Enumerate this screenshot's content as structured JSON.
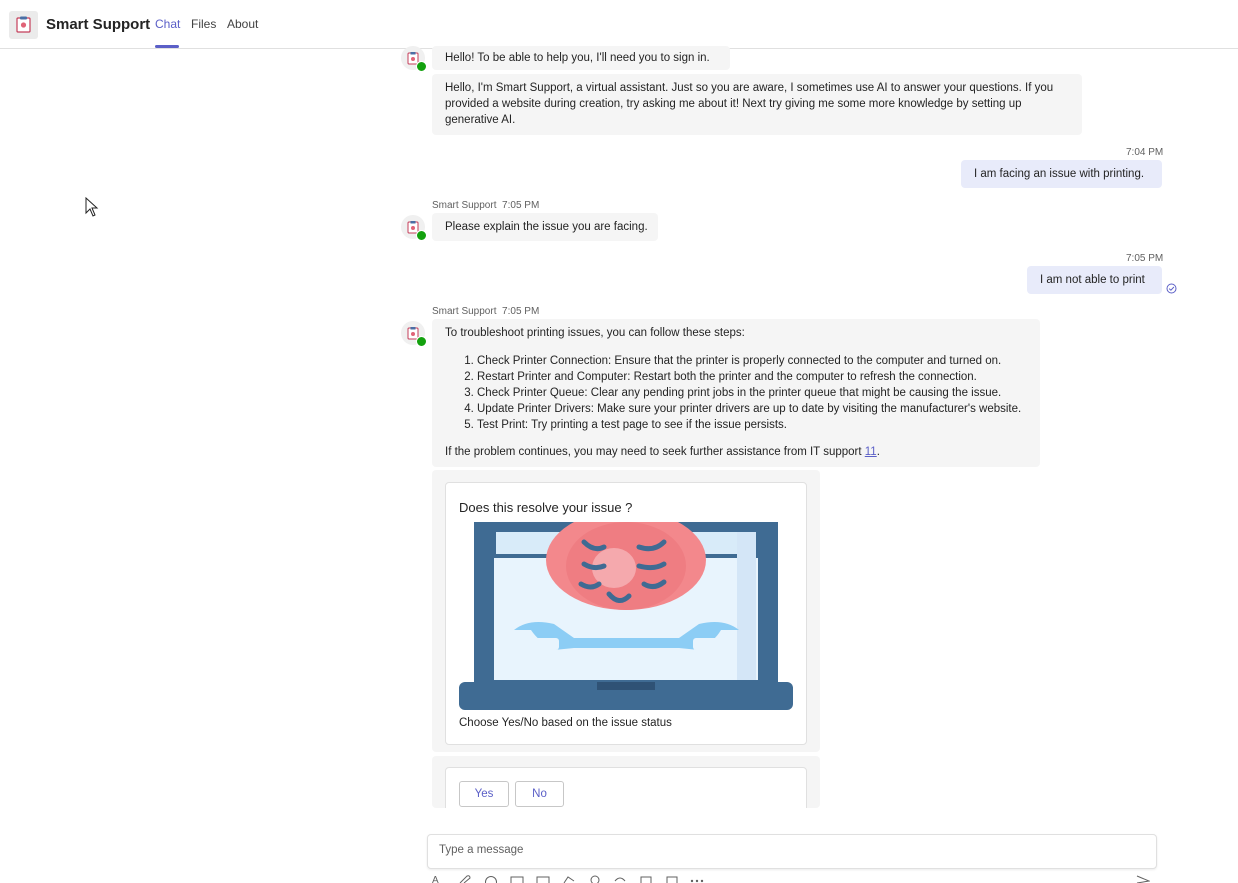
{
  "app": {
    "title": "Smart Support"
  },
  "tabs": [
    {
      "label": "Chat",
      "active": true
    },
    {
      "label": "Files",
      "active": false
    },
    {
      "label": "About",
      "active": false
    }
  ],
  "messages": {
    "m1": {
      "text": "Hello! To be able to help you, I'll need you to sign in."
    },
    "m2": {
      "text": "Hello, I'm Smart Support, a virtual assistant. Just so you are aware, I sometimes use AI to answer your questions. If you provided a website during creation, try asking me about it! Next try giving me some more knowledge by setting up generative AI."
    },
    "m3": {
      "time": "7:04 PM",
      "text": "I am facing an issue with printing."
    },
    "m4": {
      "sender": "Smart Support",
      "time": "7:05 PM",
      "text": "Please explain the issue you are facing."
    },
    "m5": {
      "time": "7:05 PM",
      "text": "I am not able to print"
    },
    "m6": {
      "sender": "Smart Support",
      "time": "7:05 PM",
      "intro": "To troubleshoot printing issues, you can follow these steps:",
      "steps": [
        "Check Printer Connection: Ensure that the printer is properly connected to the computer and turned on.",
        "Restart Printer and Computer: Restart both the printer and the computer to refresh the connection.",
        "Check Printer Queue: Clear any pending print jobs in the printer queue that might be causing the issue.",
        "Update Printer Drivers: Make sure your printer drivers are up to date by visiting the manufacturer's website.",
        "Test Print: Try printing a test page to see if the issue persists."
      ],
      "outro": "If the problem continues, you may need to seek further assistance from IT support",
      "citation": "11",
      "period": "."
    }
  },
  "card": {
    "title": "Does this resolve your issue ?",
    "subtitle": "Choose Yes/No based on the issue status",
    "yes_label": "Yes",
    "no_label": "No"
  },
  "compose": {
    "placeholder": "Type a message"
  },
  "colors": {
    "accent": "#5b5fc7",
    "presence": "#13a10e",
    "bot_bubble": "#f5f5f5",
    "user_bubble": "#e8ebfa"
  }
}
